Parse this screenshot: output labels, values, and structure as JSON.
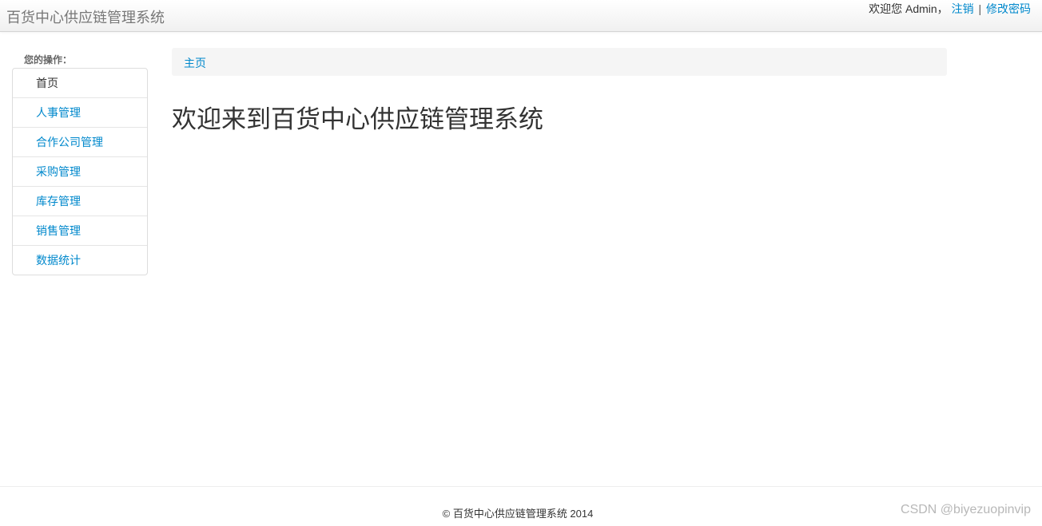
{
  "header": {
    "brand": "百货中心供应链管理系统",
    "welcome_text": "欢迎您 Admin，",
    "logout_label": "注销",
    "separator": "|",
    "change_password_label": "修改密码"
  },
  "sidebar": {
    "label": "您的操作：",
    "items": [
      {
        "label": "首页"
      },
      {
        "label": "人事管理"
      },
      {
        "label": "合作公司管理"
      },
      {
        "label": "采购管理"
      },
      {
        "label": "库存管理"
      },
      {
        "label": "销售管理"
      },
      {
        "label": "数据统计"
      }
    ]
  },
  "breadcrumb": {
    "home_label": "主页"
  },
  "main": {
    "title": "欢迎来到百货中心供应链管理系统"
  },
  "footer": {
    "copyright": "© 百货中心供应链管理系统 2014",
    "watermark": "CSDN @biyezuopinvip"
  },
  "colors": {
    "link": "#0088cc",
    "text": "#333333",
    "breadcrumb_bg": "#f5f5f5"
  }
}
